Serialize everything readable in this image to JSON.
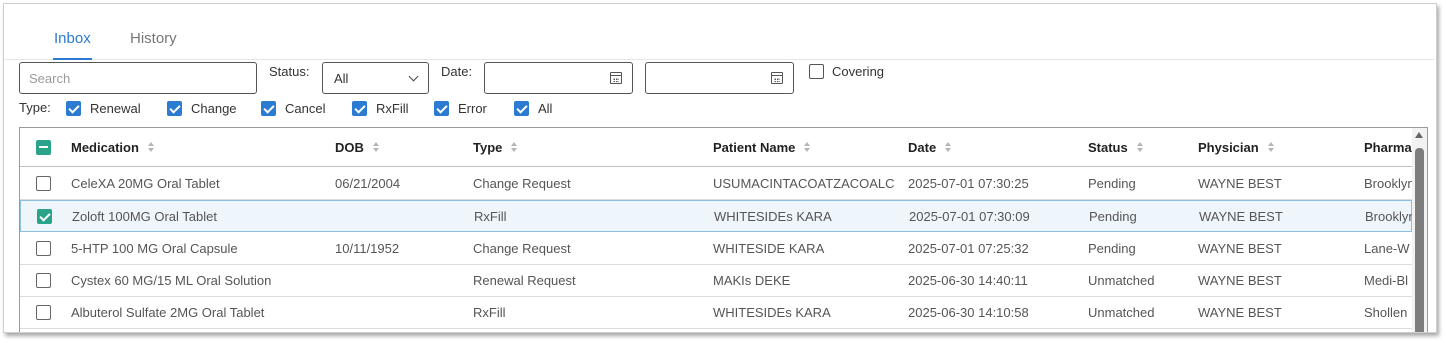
{
  "tabs": [
    {
      "label": "Inbox",
      "active": true
    },
    {
      "label": "History",
      "active": false
    }
  ],
  "filters": {
    "search_placeholder": "Search",
    "status_label": "Status:",
    "status_value": "All",
    "date_label": "Date:",
    "date_from": "",
    "date_to": "",
    "covering_label": "Covering",
    "covering_checked": false,
    "type_label": "Type:",
    "types": [
      {
        "label": "Renewal",
        "checked": true
      },
      {
        "label": "Change",
        "checked": true
      },
      {
        "label": "Cancel",
        "checked": true
      },
      {
        "label": "RxFill",
        "checked": true
      },
      {
        "label": "Error",
        "checked": true
      },
      {
        "label": "All",
        "checked": true
      }
    ]
  },
  "grid": {
    "columns": [
      "Medication",
      "DOB",
      "Type",
      "Patient Name",
      "Date",
      "Status",
      "Physician",
      "Pharmacy"
    ],
    "rows": [
      {
        "medication": "CeleXA 20MG Oral Tablet",
        "dob": "06/21/2004",
        "type": "Change Request",
        "patient": "USUMACINTACOATZACOALC...",
        "date": "2025-07-01 07:30:25",
        "status": "Pending",
        "physician": "WAYNE BEST",
        "pharmacy": "Brooklyn",
        "selected": false
      },
      {
        "medication": "Zoloft 100MG Oral Tablet",
        "dob": "",
        "type": "RxFill",
        "patient": "WHITESIDEs KARA",
        "date": "2025-07-01 07:30:09",
        "status": "Pending",
        "physician": "WAYNE BEST",
        "pharmacy": "Brooklyn",
        "selected": true
      },
      {
        "medication": "5-HTP 100 MG Oral Capsule",
        "dob": "10/11/1952",
        "type": "Change Request",
        "patient": "WHITESIDE KARA",
        "date": "2025-07-01 07:25:32",
        "status": "Pending",
        "physician": "WAYNE BEST",
        "pharmacy": "Lane-W",
        "selected": false
      },
      {
        "medication": "Cystex 60 MG/15 ML Oral Solution",
        "dob": "",
        "type": "Renewal Request",
        "patient": "MAKIs DEKE",
        "date": "2025-06-30 14:40:11",
        "status": "Unmatched",
        "physician": "WAYNE BEST",
        "pharmacy": "Medi-Bl",
        "selected": false
      },
      {
        "medication": "Albuterol Sulfate 2MG Oral Tablet",
        "dob": "",
        "type": "RxFill",
        "patient": "WHITESIDEs KARA",
        "date": "2025-06-30 14:10:58",
        "status": "Unmatched",
        "physician": "WAYNE BEST",
        "pharmacy": "Shollen",
        "selected": false
      }
    ]
  },
  "colors": {
    "accent": "#2a7bd1",
    "row_check": "#2ba38a",
    "selected_row_bg": "#eef5fb"
  }
}
